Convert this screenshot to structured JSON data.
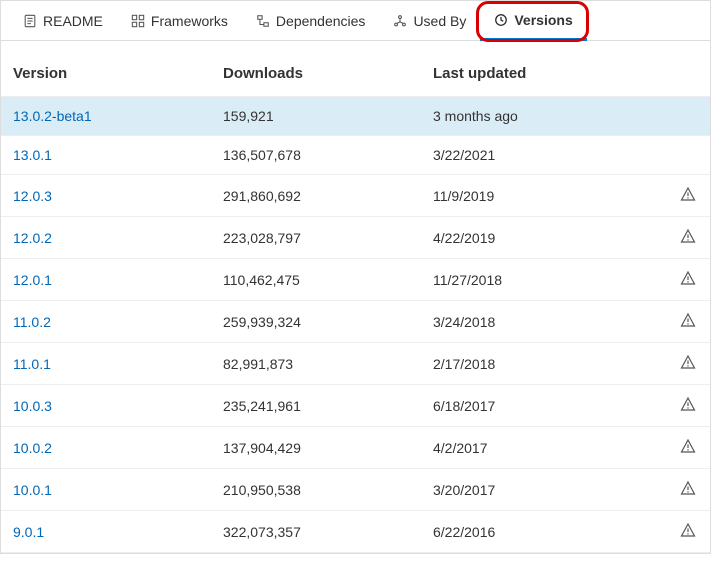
{
  "tabs": {
    "readme": "README",
    "frameworks": "Frameworks",
    "dependencies": "Dependencies",
    "usedby": "Used By",
    "versions": "Versions"
  },
  "headers": {
    "version": "Version",
    "downloads": "Downloads",
    "updated": "Last updated"
  },
  "rows": [
    {
      "version": "13.0.2-beta1",
      "downloads": "159,921",
      "updated": "3 months ago",
      "warn": false,
      "selected": true
    },
    {
      "version": "13.0.1",
      "downloads": "136,507,678",
      "updated": "3/22/2021",
      "warn": false,
      "selected": false
    },
    {
      "version": "12.0.3",
      "downloads": "291,860,692",
      "updated": "11/9/2019",
      "warn": true,
      "selected": false
    },
    {
      "version": "12.0.2",
      "downloads": "223,028,797",
      "updated": "4/22/2019",
      "warn": true,
      "selected": false
    },
    {
      "version": "12.0.1",
      "downloads": "110,462,475",
      "updated": "11/27/2018",
      "warn": true,
      "selected": false
    },
    {
      "version": "11.0.2",
      "downloads": "259,939,324",
      "updated": "3/24/2018",
      "warn": true,
      "selected": false
    },
    {
      "version": "11.0.1",
      "downloads": "82,991,873",
      "updated": "2/17/2018",
      "warn": true,
      "selected": false
    },
    {
      "version": "10.0.3",
      "downloads": "235,241,961",
      "updated": "6/18/2017",
      "warn": true,
      "selected": false
    },
    {
      "version": "10.0.2",
      "downloads": "137,904,429",
      "updated": "4/2/2017",
      "warn": true,
      "selected": false
    },
    {
      "version": "10.0.1",
      "downloads": "210,950,538",
      "updated": "3/20/2017",
      "warn": true,
      "selected": false
    },
    {
      "version": "9.0.1",
      "downloads": "322,073,357",
      "updated": "6/22/2016",
      "warn": true,
      "selected": false
    }
  ],
  "annotation": {
    "highlight_tab": "versions"
  }
}
